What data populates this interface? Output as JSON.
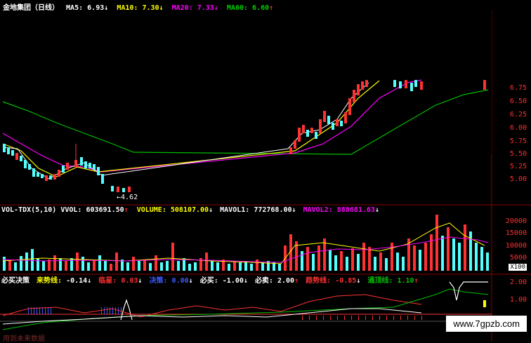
{
  "header": {
    "stock": "金地集团（日线）",
    "ma5_label": "MA5:",
    "ma5_value": "6.93",
    "ma5_arrow": "↓",
    "ma10_label": "MA10:",
    "ma10_value": "7.30",
    "ma10_arrow": "↓",
    "ma20_label": "MA20:",
    "ma20_value": "7.33",
    "ma20_arrow": "↓",
    "ma60_label": "MA60:",
    "ma60_value": "6.60",
    "ma60_arrow": "↑"
  },
  "price_axis": [
    "6.75",
    "6.50",
    "6.25",
    "6.00",
    "5.75",
    "5.50",
    "5.25",
    "5.00"
  ],
  "low_marker": "←4.62",
  "volume_header": {
    "name": "VOL-TDX(5,10)",
    "vvol_label": "VVOL:",
    "vvol_value": "603691.50",
    "vvol_arrow": "↑",
    "volume_label": "VOLUME:",
    "volume_value": "508107.00",
    "volume_arrow": "↓",
    "mavol1_label": "MAVOL1:",
    "mavol1_value": "772768.00",
    "mavol1_arrow": "↓",
    "mavol2_label": "MAVOL2:",
    "mavol2_value": "888681.63",
    "mavol2_arrow": "↓"
  },
  "volume_axis": [
    "20000",
    "15000",
    "10000",
    "5000"
  ],
  "volume_unit": "X100",
  "indicator_header": {
    "name": "必买决策",
    "item1_label": "来势线:",
    "item1_value": "-0.14",
    "item1_arrow": "↓",
    "item2_label": "临星:",
    "item2_value": "0.03",
    "item2_arrow": "↓",
    "item3_label": "决策:",
    "item3_value": "0.00",
    "item3_arrow": "↓",
    "item4_label": "必买:",
    "item4_value": "-1.00",
    "item4_arrow": "↓",
    "item5_label": "必卖:",
    "item5_value": "2.00",
    "item5_arrow": "↑",
    "item6_label": "趋势线:",
    "item6_value": "-0.85",
    "item6_arrow": "↓",
    "item7_label": "通顶线:",
    "item7_value": "1.10",
    "item7_arrow": "↑"
  },
  "indicator_axis": [
    "2.00",
    "1.00"
  ],
  "footer_text": "用到未来数据",
  "watermark": "www.7gpzb.com",
  "colors": {
    "up": "#ff3232",
    "down": "#54ffff",
    "ma5": "#ffffff",
    "ma10": "#ffff00",
    "ma20": "#ff00ff",
    "ma60": "#00c000",
    "axis": "#ff3030"
  }
}
